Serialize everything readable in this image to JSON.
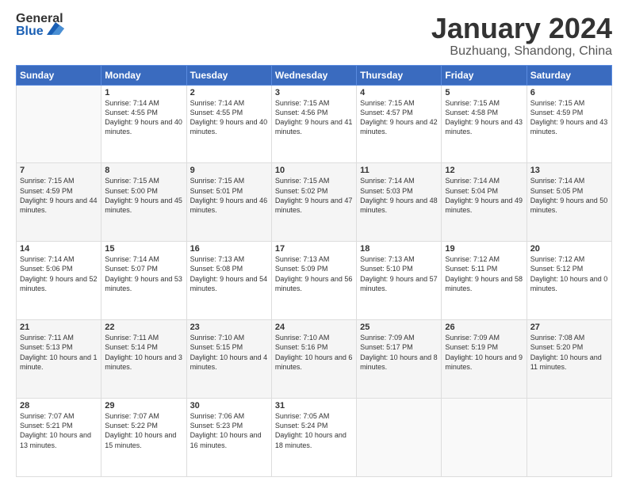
{
  "header": {
    "logo_general": "General",
    "logo_blue": "Blue",
    "title": "January 2024",
    "subtitle": "Buzhuang, Shandong, China"
  },
  "days_of_week": [
    "Sunday",
    "Monday",
    "Tuesday",
    "Wednesday",
    "Thursday",
    "Friday",
    "Saturday"
  ],
  "weeks": [
    [
      {
        "day": "",
        "sunrise": "",
        "sunset": "",
        "daylight": ""
      },
      {
        "day": "1",
        "sunrise": "Sunrise: 7:14 AM",
        "sunset": "Sunset: 4:55 PM",
        "daylight": "Daylight: 9 hours and 40 minutes."
      },
      {
        "day": "2",
        "sunrise": "Sunrise: 7:14 AM",
        "sunset": "Sunset: 4:55 PM",
        "daylight": "Daylight: 9 hours and 40 minutes."
      },
      {
        "day": "3",
        "sunrise": "Sunrise: 7:15 AM",
        "sunset": "Sunset: 4:56 PM",
        "daylight": "Daylight: 9 hours and 41 minutes."
      },
      {
        "day": "4",
        "sunrise": "Sunrise: 7:15 AM",
        "sunset": "Sunset: 4:57 PM",
        "daylight": "Daylight: 9 hours and 42 minutes."
      },
      {
        "day": "5",
        "sunrise": "Sunrise: 7:15 AM",
        "sunset": "Sunset: 4:58 PM",
        "daylight": "Daylight: 9 hours and 43 minutes."
      },
      {
        "day": "6",
        "sunrise": "Sunrise: 7:15 AM",
        "sunset": "Sunset: 4:59 PM",
        "daylight": "Daylight: 9 hours and 43 minutes."
      }
    ],
    [
      {
        "day": "7",
        "sunrise": "Sunrise: 7:15 AM",
        "sunset": "Sunset: 4:59 PM",
        "daylight": "Daylight: 9 hours and 44 minutes."
      },
      {
        "day": "8",
        "sunrise": "Sunrise: 7:15 AM",
        "sunset": "Sunset: 5:00 PM",
        "daylight": "Daylight: 9 hours and 45 minutes."
      },
      {
        "day": "9",
        "sunrise": "Sunrise: 7:15 AM",
        "sunset": "Sunset: 5:01 PM",
        "daylight": "Daylight: 9 hours and 46 minutes."
      },
      {
        "day": "10",
        "sunrise": "Sunrise: 7:15 AM",
        "sunset": "Sunset: 5:02 PM",
        "daylight": "Daylight: 9 hours and 47 minutes."
      },
      {
        "day": "11",
        "sunrise": "Sunrise: 7:14 AM",
        "sunset": "Sunset: 5:03 PM",
        "daylight": "Daylight: 9 hours and 48 minutes."
      },
      {
        "day": "12",
        "sunrise": "Sunrise: 7:14 AM",
        "sunset": "Sunset: 5:04 PM",
        "daylight": "Daylight: 9 hours and 49 minutes."
      },
      {
        "day": "13",
        "sunrise": "Sunrise: 7:14 AM",
        "sunset": "Sunset: 5:05 PM",
        "daylight": "Daylight: 9 hours and 50 minutes."
      }
    ],
    [
      {
        "day": "14",
        "sunrise": "Sunrise: 7:14 AM",
        "sunset": "Sunset: 5:06 PM",
        "daylight": "Daylight: 9 hours and 52 minutes."
      },
      {
        "day": "15",
        "sunrise": "Sunrise: 7:14 AM",
        "sunset": "Sunset: 5:07 PM",
        "daylight": "Daylight: 9 hours and 53 minutes."
      },
      {
        "day": "16",
        "sunrise": "Sunrise: 7:13 AM",
        "sunset": "Sunset: 5:08 PM",
        "daylight": "Daylight: 9 hours and 54 minutes."
      },
      {
        "day": "17",
        "sunrise": "Sunrise: 7:13 AM",
        "sunset": "Sunset: 5:09 PM",
        "daylight": "Daylight: 9 hours and 56 minutes."
      },
      {
        "day": "18",
        "sunrise": "Sunrise: 7:13 AM",
        "sunset": "Sunset: 5:10 PM",
        "daylight": "Daylight: 9 hours and 57 minutes."
      },
      {
        "day": "19",
        "sunrise": "Sunrise: 7:12 AM",
        "sunset": "Sunset: 5:11 PM",
        "daylight": "Daylight: 9 hours and 58 minutes."
      },
      {
        "day": "20",
        "sunrise": "Sunrise: 7:12 AM",
        "sunset": "Sunset: 5:12 PM",
        "daylight": "Daylight: 10 hours and 0 minutes."
      }
    ],
    [
      {
        "day": "21",
        "sunrise": "Sunrise: 7:11 AM",
        "sunset": "Sunset: 5:13 PM",
        "daylight": "Daylight: 10 hours and 1 minute."
      },
      {
        "day": "22",
        "sunrise": "Sunrise: 7:11 AM",
        "sunset": "Sunset: 5:14 PM",
        "daylight": "Daylight: 10 hours and 3 minutes."
      },
      {
        "day": "23",
        "sunrise": "Sunrise: 7:10 AM",
        "sunset": "Sunset: 5:15 PM",
        "daylight": "Daylight: 10 hours and 4 minutes."
      },
      {
        "day": "24",
        "sunrise": "Sunrise: 7:10 AM",
        "sunset": "Sunset: 5:16 PM",
        "daylight": "Daylight: 10 hours and 6 minutes."
      },
      {
        "day": "25",
        "sunrise": "Sunrise: 7:09 AM",
        "sunset": "Sunset: 5:17 PM",
        "daylight": "Daylight: 10 hours and 8 minutes."
      },
      {
        "day": "26",
        "sunrise": "Sunrise: 7:09 AM",
        "sunset": "Sunset: 5:19 PM",
        "daylight": "Daylight: 10 hours and 9 minutes."
      },
      {
        "day": "27",
        "sunrise": "Sunrise: 7:08 AM",
        "sunset": "Sunset: 5:20 PM",
        "daylight": "Daylight: 10 hours and 11 minutes."
      }
    ],
    [
      {
        "day": "28",
        "sunrise": "Sunrise: 7:07 AM",
        "sunset": "Sunset: 5:21 PM",
        "daylight": "Daylight: 10 hours and 13 minutes."
      },
      {
        "day": "29",
        "sunrise": "Sunrise: 7:07 AM",
        "sunset": "Sunset: 5:22 PM",
        "daylight": "Daylight: 10 hours and 15 minutes."
      },
      {
        "day": "30",
        "sunrise": "Sunrise: 7:06 AM",
        "sunset": "Sunset: 5:23 PM",
        "daylight": "Daylight: 10 hours and 16 minutes."
      },
      {
        "day": "31",
        "sunrise": "Sunrise: 7:05 AM",
        "sunset": "Sunset: 5:24 PM",
        "daylight": "Daylight: 10 hours and 18 minutes."
      },
      {
        "day": "",
        "sunrise": "",
        "sunset": "",
        "daylight": ""
      },
      {
        "day": "",
        "sunrise": "",
        "sunset": "",
        "daylight": ""
      },
      {
        "day": "",
        "sunrise": "",
        "sunset": "",
        "daylight": ""
      }
    ]
  ]
}
